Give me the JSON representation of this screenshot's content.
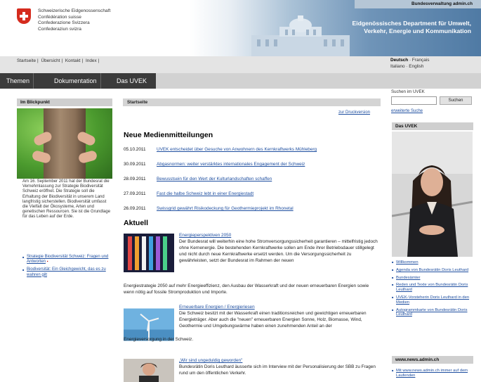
{
  "header": {
    "confederation_lines": [
      "Schweizerische Eidgenossenschaft",
      "Confédération suisse",
      "Confederazione Svizzera",
      "Confederaziun svizra"
    ],
    "portal_link": "Bundesverwaltung admin.ch",
    "department": [
      "Eidgenössisches Department für Umwelt,",
      "Verkehr, Energie und Kommunikation"
    ]
  },
  "service_nav": [
    "Startseite",
    "Übersicht",
    "Kontakt",
    "Index"
  ],
  "languages": {
    "active": "Deutsch",
    "others": [
      "Français",
      "Italiano",
      "English"
    ]
  },
  "main_nav": [
    "Themen",
    "Dokumentation",
    "Das UVEK"
  ],
  "left": {
    "box_title": "Im Blickpunkt",
    "teaser_text": "Am 16. September 2011 hat der Bundesrat die Vernehmlassung zur Strategie Biodiversität Schweiz eröffnet. Die Strategie soll die Erhaltung der Biodiversität in unserem Land langfristig sicherstellen. Biodiversität umfasst die Vielfalt der Ökosysteme, Arten und genetischen Ressourcen. Sie ist die Grundlage für das Leben auf der Erde.",
    "links": [
      "Strategie Biodiversität Schweiz: Fragen und Antworten",
      "Biodiversität: Ein Gleichgewicht, das es zu wahren gilt"
    ]
  },
  "center": {
    "breadcrumb": "Startseite",
    "print_link": "zur Druckversion",
    "news_heading": "Neue Medienmitteilungen",
    "news": [
      {
        "date": "05.10.2011",
        "title": "UVEK entscheidet über Gesuche von Anwohnern des Kernkraftwerks Mühleberg"
      },
      {
        "date": "30.09.2011",
        "title": "Abgasnormen: weiter verstärktes internationales Engagement der Schweiz"
      },
      {
        "date": "28.09.2011",
        "title": "Bewusstsein für den Wert der Kulturlandschaften schaffen"
      },
      {
        "date": "27.09.2011",
        "title": "Fast die halbe Schweiz lebt in einer Energiestadt"
      },
      {
        "date": "26.09.2011",
        "title": "Swissgrid gewährt Risikodeckung für Geothermieprojekt im Rhonetal"
      }
    ],
    "current_heading": "Aktuell",
    "articles": [
      {
        "title": "Energieperspektiven 2050",
        "body": "Der Bundesrat will weiterhin eine hohe Stromversorgungssicherheit garantieren – mittelfristig jedoch ohne Kernenergie. Die bestehenden Kernkraftwerke sollen am Ende ihrer Betriebsdauer stillgelegt und nicht durch neue Kernkraftwerke ersetzt werden. Um die Versorgungssicherheit zu gewährleisten, setzt der Bundesrat im Rahmen der neuen",
        "cont": "Energiestrategie 2050 auf mehr Energieeffizienz, den Ausbau der Wasserkraft und der neuen erneuerbaren Energien sowie wenn nötig auf fossile Stromproduktion und Importe."
      },
      {
        "title": "Erneuerbare Energien / Energieriesen",
        "body": "Die Schweiz besitzt mit der Wasserkraft einen traditionsreichen und gewichtigen erneuerbaren Energieträger. Aber auch die \"neuen\" erneuerbaren Energien Sonne, Holz, Biomasse, Wind, Geothermie und Umgebungswärme haben einen zunehmenden Anteil an der",
        "cont": "Energieversorgung in der Schweiz."
      },
      {
        "title": "„Wir sind ungeduldig geworden\"",
        "body": "Bundesrätin Doris Leuthard äusserte sich im Interview mit der Personalisierung der SBB zu Fragen rund um den öffentlichen Verkehr."
      }
    ]
  },
  "right": {
    "search_label": "Suchen im UVEK",
    "search_value": "",
    "search_button": "Suchen",
    "extended_search": "erweiterte Suche",
    "box_title": "Das UVEK",
    "links": [
      "Willkommen",
      "Agenda von Bundesrätin Doris Leuthard",
      "Bundesämter",
      "Reden und Texte von Bundesrätin Doris Leuthard",
      "UVEK-Vorsteherin Doris Leuthard in den Medien",
      "Autogrammkarte von Bundesrätin Doris Leuthard"
    ],
    "news_box_title": "www.news.admin.ch",
    "news_box_link": "Mit www.news.admin.ch immer auf dem Laufenden"
  },
  "icons": {
    "crest": "swiss-crest-icon",
    "pdf": "pdf-icon"
  },
  "colors": {
    "link": "#1f4fa0",
    "nav_dark": "#3b3b3b",
    "crest_red": "#d52b1e",
    "banner_blue": "#4f7aa4"
  }
}
